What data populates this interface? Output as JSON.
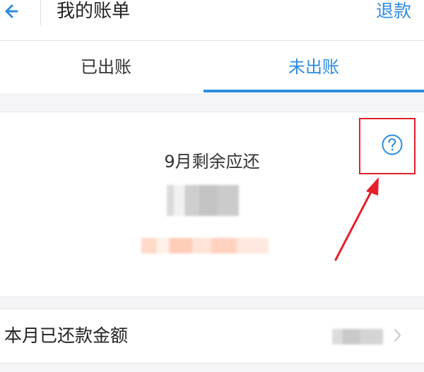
{
  "header": {
    "title": "我的账单",
    "refund_label": "退款"
  },
  "tabs": [
    {
      "label": "已出账",
      "active": false
    },
    {
      "label": "未出账",
      "active": true
    }
  ],
  "summary": {
    "title": "9月剩余应还"
  },
  "paid_row": {
    "label": "本月已还款金额"
  },
  "colors": {
    "accent": "#2d8ce0",
    "annotation_red": "#e5202a"
  },
  "icons": {
    "back": "back-arrow-icon",
    "help": "question-circle-icon",
    "chevron": "chevron-right-icon"
  }
}
